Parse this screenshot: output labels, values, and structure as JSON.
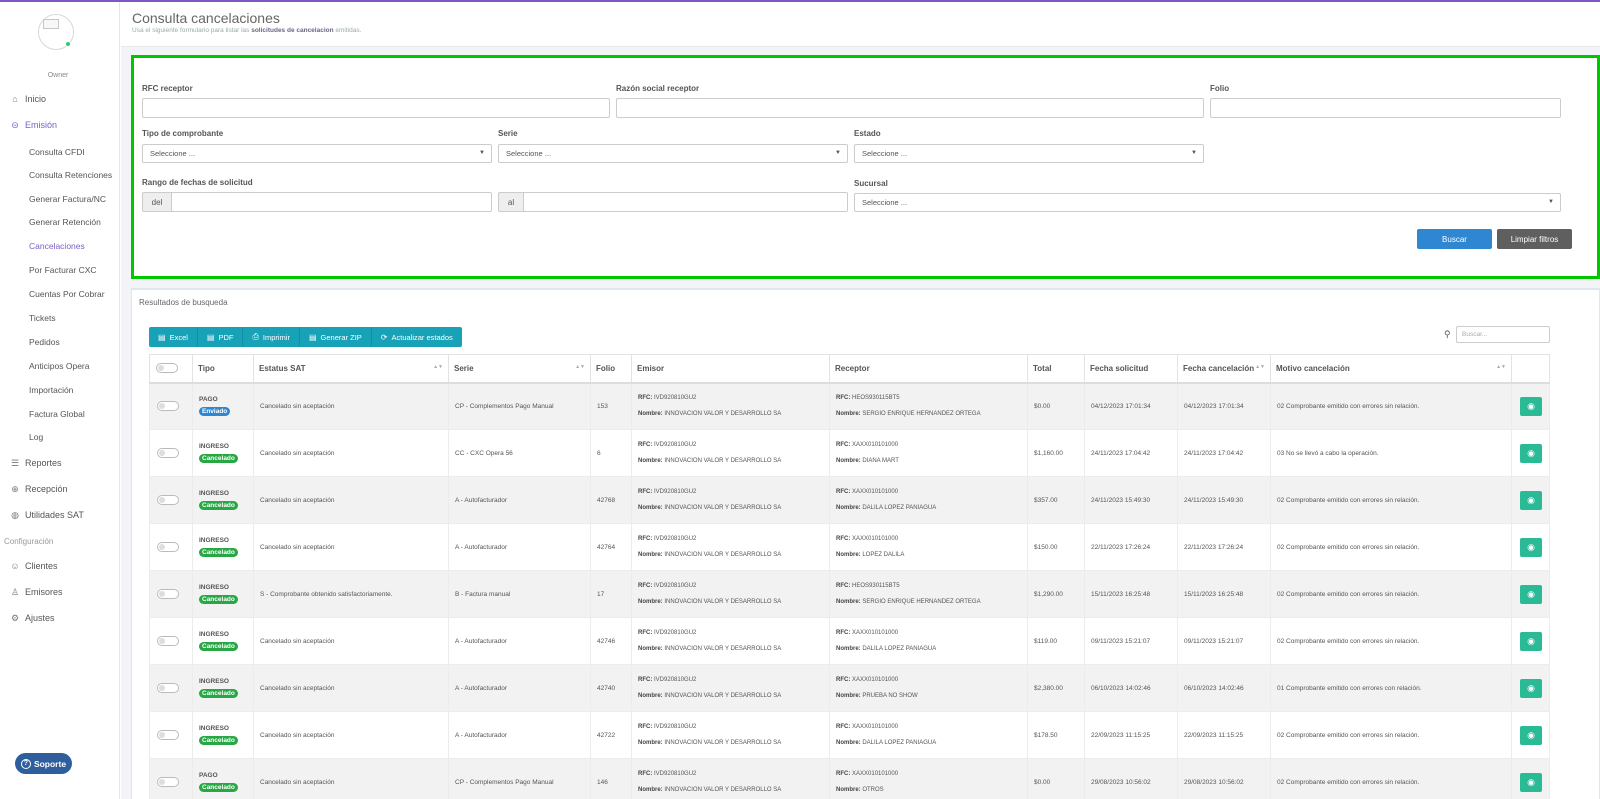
{
  "sidebar": {
    "role": "Owner",
    "nav": [
      {
        "label": "Inicio",
        "icon": "home-icon"
      },
      {
        "label": "Emisión",
        "icon": "circle-chevron-icon"
      }
    ],
    "sub_items": [
      "Consulta CFDI",
      "Consulta Retenciones",
      "Generar Factura/NC",
      "Generar Retención",
      "Cancelaciones",
      "Por Facturar CXC",
      "Cuentas Por Cobrar",
      "Tickets",
      "Pedidos",
      "Anticipos Opera",
      "Importación",
      "Factura Global",
      "Log"
    ],
    "nav2": [
      {
        "label": "Reportes",
        "icon": "list-icon"
      },
      {
        "label": "Recepción",
        "icon": "circle-arrow-icon"
      },
      {
        "label": "Utilidades SAT",
        "icon": "globe-icon"
      }
    ],
    "config_label": "Configuración",
    "nav3": [
      {
        "label": "Clientes",
        "icon": "users-icon"
      },
      {
        "label": "Emisores",
        "icon": "user-icon"
      },
      {
        "label": "Ajustes",
        "icon": "gear-icon"
      }
    ],
    "support_label": "Soporte"
  },
  "header": {
    "title": "Consulta cancelaciones",
    "subtitle_prefix": "Usa el siguiente formulario para listar las ",
    "subtitle_bold": "solicitudes de cancelacion",
    "subtitle_suffix": " emitidas."
  },
  "filters": {
    "rfc_label": "RFC receptor",
    "razon_label": "Razón social receptor",
    "folio_label": "Folio",
    "tipo_label": "Tipo de comprobante",
    "tipo_value": "Seleccione ...",
    "serie_label": "Serie",
    "serie_value": "Seleccione ...",
    "estado_label": "Estado",
    "estado_value": "Seleccione ...",
    "rango_label": "Rango de fechas de solicitud",
    "del_label": "del",
    "al_label": "al",
    "sucursal_label": "Sucursal",
    "sucursal_value": "Seleccione ...",
    "buscar_label": "Buscar",
    "limpiar_label": "Limpiar filtros"
  },
  "results": {
    "title": "Resultados de busqueda",
    "toolbar": [
      {
        "label": "Excel",
        "icon": "file-excel-icon"
      },
      {
        "label": "PDF",
        "icon": "file-pdf-icon"
      },
      {
        "label": "Imprimir",
        "icon": "print-icon"
      },
      {
        "label": "Generar ZIP",
        "icon": "file-zip-icon"
      },
      {
        "label": "Actualizar estados",
        "icon": "refresh-icon"
      }
    ],
    "search_placeholder": "Buscar...",
    "columns": [
      "Tipo",
      "Estatus SAT",
      "Serie",
      "Folio",
      "Emisor",
      "Receptor",
      "Total",
      "Fecha solicitud",
      "Fecha cancelación",
      "Motivo cancelación"
    ],
    "rfc_key": "RFC:",
    "nombre_key": "Nombre:",
    "rows": [
      {
        "tipo": "PAGO",
        "badge": "Enviado",
        "estatus": "Cancelado sin aceptación",
        "serie": "CP - Complementos Pago Manual",
        "folio": "153",
        "emisor_rfc": "IVD920810GU2",
        "emisor_nombre": "INNOVACION VALOR Y DESARROLLO SA",
        "receptor_rfc": "HEOS930115BT5",
        "receptor_nombre": "SERGIO ENRIQUE HERNANDEZ ORTEGA",
        "total": "$0.00",
        "fsol": "04/12/2023 17:01:34",
        "fcan": "04/12/2023 17:01:34",
        "motivo": "02 Comprobante emitido con errores sin relación."
      },
      {
        "tipo": "INGRESO",
        "badge": "Cancelado",
        "estatus": "Cancelado sin aceptación",
        "serie": "CC - CXC Opera 56",
        "folio": "6",
        "emisor_rfc": "IVD920810GU2",
        "emisor_nombre": "INNOVACION VALOR Y DESARROLLO SA",
        "receptor_rfc": "XAXX010101000",
        "receptor_nombre": "DIANA MART",
        "total": "$1,160.00",
        "fsol": "24/11/2023 17:04:42",
        "fcan": "24/11/2023 17:04:42",
        "motivo": "03 No se llevó a cabo la operación."
      },
      {
        "tipo": "INGRESO",
        "badge": "Cancelado",
        "estatus": "Cancelado sin aceptación",
        "serie": "A - Autofacturador",
        "folio": "42768",
        "emisor_rfc": "IVD920810GU2",
        "emisor_nombre": "INNOVACION VALOR Y DESARROLLO SA",
        "receptor_rfc": "XAXX010101000",
        "receptor_nombre": "DALILA LOPEZ PANIAGUA",
        "total": "$357.00",
        "fsol": "24/11/2023 15:49:30",
        "fcan": "24/11/2023 15:49:30",
        "motivo": "02 Comprobante emitido con errores sin relación."
      },
      {
        "tipo": "INGRESO",
        "badge": "Cancelado",
        "estatus": "Cancelado sin aceptación",
        "serie": "A - Autofacturador",
        "folio": "42764",
        "emisor_rfc": "IVD920810GU2",
        "emisor_nombre": "INNOVACION VALOR Y DESARROLLO SA",
        "receptor_rfc": "XAXX010101000",
        "receptor_nombre": "LOPEZ DALILA",
        "total": "$150.00",
        "fsol": "22/11/2023 17:26:24",
        "fcan": "22/11/2023 17:26:24",
        "motivo": "02 Comprobante emitido con errores sin relación."
      },
      {
        "tipo": "INGRESO",
        "badge": "Cancelado",
        "estatus": "S - Comprobante obtenido satisfactoriamente.",
        "serie": "B - Factura manual",
        "folio": "17",
        "emisor_rfc": "IVD920810GU2",
        "emisor_nombre": "INNOVACION VALOR Y DESARROLLO SA",
        "receptor_rfc": "HEOS930115BT5",
        "receptor_nombre": "SERGIO ENRIQUE HERNANDEZ ORTEGA",
        "total": "$1,290.00",
        "fsol": "15/11/2023 16:25:48",
        "fcan": "15/11/2023 16:25:48",
        "motivo": "02 Comprobante emitido con errores sin relación."
      },
      {
        "tipo": "INGRESO",
        "badge": "Cancelado",
        "estatus": "Cancelado sin aceptación",
        "serie": "A - Autofacturador",
        "folio": "42746",
        "emisor_rfc": "IVD920810GU2",
        "emisor_nombre": "INNOVACION VALOR Y DESARROLLO SA",
        "receptor_rfc": "XAXX010101000",
        "receptor_nombre": "DALILA LOPEZ PANIAGUA",
        "total": "$119.00",
        "fsol": "09/11/2023 15:21:07",
        "fcan": "09/11/2023 15:21:07",
        "motivo": "02 Comprobante emitido con errores sin relación."
      },
      {
        "tipo": "INGRESO",
        "badge": "Cancelado",
        "estatus": "Cancelado sin aceptación",
        "serie": "A - Autofacturador",
        "folio": "42740",
        "emisor_rfc": "IVD920810GU2",
        "emisor_nombre": "INNOVACION VALOR Y DESARROLLO SA",
        "receptor_rfc": "XAXX010101000",
        "receptor_nombre": "PRUEBA NO SHOW",
        "total": "$2,380.00",
        "fsol": "06/10/2023 14:02:46",
        "fcan": "06/10/2023 14:02:46",
        "motivo": "01 Comprobante emitido con errores con relación."
      },
      {
        "tipo": "INGRESO",
        "badge": "Cancelado",
        "estatus": "Cancelado sin aceptación",
        "serie": "A - Autofacturador",
        "folio": "42722",
        "emisor_rfc": "IVD920810GU2",
        "emisor_nombre": "INNOVACION VALOR Y DESARROLLO SA",
        "receptor_rfc": "XAXX010101000",
        "receptor_nombre": "DALILA LOPEZ PANIAGUA",
        "total": "$178.50",
        "fsol": "22/09/2023 11:15:25",
        "fcan": "22/09/2023 11:15:25",
        "motivo": "02 Comprobante emitido con errores sin relación."
      },
      {
        "tipo": "PAGO",
        "badge": "Cancelado",
        "estatus": "Cancelado sin aceptación",
        "serie": "CP - Complementos Pago Manual",
        "folio": "146",
        "emisor_rfc": "IVD920810GU2",
        "emisor_nombre": "INNOVACION VALOR Y DESARROLLO SA",
        "receptor_rfc": "XAXX010101000",
        "receptor_nombre": "OTROS",
        "total": "$0.00",
        "fsol": "29/08/2023 10:56:02",
        "fcan": "29/08/2023 10:56:02",
        "motivo": "02 Comprobante emitido con errores sin relación."
      }
    ]
  },
  "colors": {
    "accent": "#7b61c4",
    "filter_border": "#00c800",
    "primary": "#2f86d1",
    "info": "#17a2b8",
    "success": "#28a745",
    "view": "#2bba96"
  }
}
